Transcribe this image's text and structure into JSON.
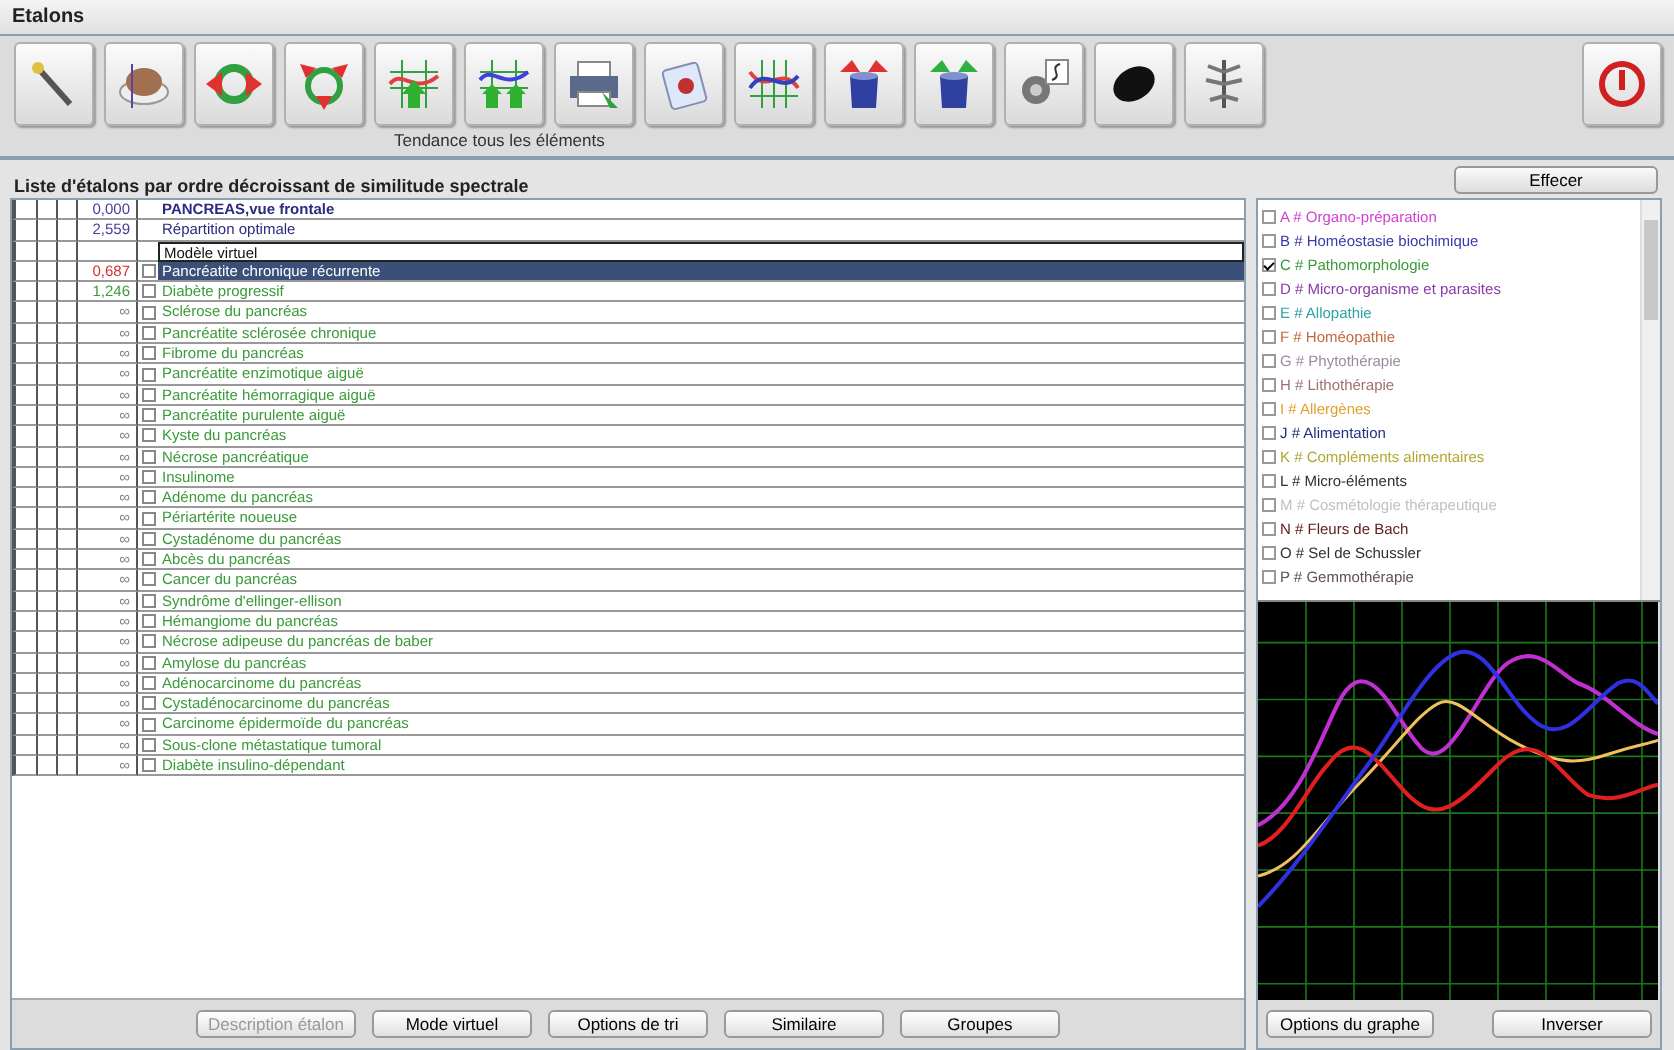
{
  "window": {
    "title": "Etalons"
  },
  "toolbar": {
    "buttons": [
      {
        "kind": "wand"
      },
      {
        "kind": "dish"
      },
      {
        "kind": "ring"
      },
      {
        "kind": "triangle"
      },
      {
        "kind": "graph-up"
      },
      {
        "kind": "graph-up2"
      },
      {
        "kind": "printer"
      },
      {
        "kind": "notepad"
      },
      {
        "kind": "waves"
      },
      {
        "kind": "cup-red"
      },
      {
        "kind": "cup-green"
      },
      {
        "kind": "gears"
      },
      {
        "kind": "stone"
      },
      {
        "kind": "plant"
      },
      {
        "kind": "power"
      }
    ],
    "caption": "Tendance tous les éléments"
  },
  "list_header": "Liste d'étalons par ordre décroissant de similitude spectrale",
  "clear_button": "Effecer",
  "table": {
    "rows": [
      {
        "kind": "reference",
        "value": "0,000",
        "color": "#4a3a9a",
        "name": "PANCREAS,vue frontale",
        "selected": false
      },
      {
        "kind": "optimal",
        "value": "2,559",
        "color": "#4a3a9a",
        "name": "Répartition optimale",
        "selected": false
      },
      {
        "kind": "virtual",
        "name": "Modèle virtuel",
        "selected": false
      },
      {
        "kind": "item",
        "value": "0,687",
        "color": "#d03030",
        "name": "Pancréatite chronique récurrente",
        "checked": false,
        "selected": true
      },
      {
        "kind": "item",
        "value": "1,246",
        "color": "#3a9a3a",
        "name": "Diabète progressif",
        "checked": false,
        "selected": false
      },
      {
        "kind": "item",
        "value": "∞",
        "color": "#808080",
        "name": "Sclérose du pancréas",
        "checked": false,
        "selected": false
      },
      {
        "kind": "item",
        "value": "∞",
        "color": "#808080",
        "name": "Pancréatite sclérosée chronique",
        "checked": false,
        "selected": false
      },
      {
        "kind": "item",
        "value": "∞",
        "color": "#808080",
        "name": "Fibrome du pancréas",
        "checked": false,
        "selected": false
      },
      {
        "kind": "item",
        "value": "∞",
        "color": "#808080",
        "name": "Pancréatite enzimotique aiguë",
        "checked": false,
        "selected": false
      },
      {
        "kind": "item",
        "value": "∞",
        "color": "#808080",
        "name": "Pancréatite hémorragique aiguë",
        "checked": false,
        "selected": false
      },
      {
        "kind": "item",
        "value": "∞",
        "color": "#808080",
        "name": "Pancréatite purulente aiguë",
        "checked": false,
        "selected": false
      },
      {
        "kind": "item",
        "value": "∞",
        "color": "#808080",
        "name": "Kyste du pancréas",
        "checked": false,
        "selected": false
      },
      {
        "kind": "item",
        "value": "∞",
        "color": "#808080",
        "name": "Nécrose pancréatique",
        "checked": false,
        "selected": false
      },
      {
        "kind": "item",
        "value": "∞",
        "color": "#808080",
        "name": "Insulinome",
        "checked": false,
        "selected": false
      },
      {
        "kind": "item",
        "value": "∞",
        "color": "#808080",
        "name": "Adénome du pancréas",
        "checked": false,
        "selected": false
      },
      {
        "kind": "item",
        "value": "∞",
        "color": "#808080",
        "name": "Périartérite noueuse",
        "checked": false,
        "selected": false
      },
      {
        "kind": "item",
        "value": "∞",
        "color": "#808080",
        "name": "Cystadénome du pancréas",
        "checked": false,
        "selected": false
      },
      {
        "kind": "item",
        "value": "∞",
        "color": "#808080",
        "name": "Abcès du pancréas",
        "checked": false,
        "selected": false
      },
      {
        "kind": "item",
        "value": "∞",
        "color": "#808080",
        "name": "Cancer du pancréas",
        "checked": false,
        "selected": false
      },
      {
        "kind": "item",
        "value": "∞",
        "color": "#808080",
        "name": "Syndrôme d'ellinger-ellison",
        "checked": false,
        "selected": false
      },
      {
        "kind": "item",
        "value": "∞",
        "color": "#808080",
        "name": "Hémangiome du pancréas",
        "checked": false,
        "selected": false
      },
      {
        "kind": "item",
        "value": "∞",
        "color": "#808080",
        "name": "Nécrose adipeuse du pancréas de baber",
        "checked": false,
        "selected": false
      },
      {
        "kind": "item",
        "value": "∞",
        "color": "#808080",
        "name": "Amylose du pancréas",
        "checked": false,
        "selected": false
      },
      {
        "kind": "item",
        "value": "∞",
        "color": "#808080",
        "name": "Adénocarcinome du pancréas",
        "checked": false,
        "selected": false
      },
      {
        "kind": "item",
        "value": "∞",
        "color": "#808080",
        "name": "Cystadénocarcinome du pancréas",
        "checked": false,
        "selected": false
      },
      {
        "kind": "item",
        "value": "∞",
        "color": "#808080",
        "name": "Carcinome épidermoïde du pancréas",
        "checked": false,
        "selected": false
      },
      {
        "kind": "item",
        "value": "∞",
        "color": "#808080",
        "name": "Sous-clone métastatique tumoral",
        "checked": false,
        "selected": false
      },
      {
        "kind": "item",
        "value": "∞",
        "color": "#808080",
        "name": "Diabète insulino-dépendant",
        "checked": false,
        "selected": false
      }
    ]
  },
  "table_buttons": [
    {
      "label": "Description étalon",
      "disabled": true
    },
    {
      "label": "Mode virtuel",
      "disabled": false
    },
    {
      "label": "Options de tri",
      "disabled": false
    },
    {
      "label": "Similaire",
      "disabled": false
    },
    {
      "label": "Groupes",
      "disabled": false
    }
  ],
  "groups": [
    {
      "label": "A # Organo-préparation",
      "color": "#d040d0",
      "checked": false
    },
    {
      "label": "B # Homéostasie biochimique",
      "color": "#3a3aa8",
      "checked": false
    },
    {
      "label": "C # Pathomorphologie",
      "color": "#3a9a3a",
      "checked": true
    },
    {
      "label": "D # Micro-organisme et parasites",
      "color": "#8a3aa8",
      "checked": false
    },
    {
      "label": "E # Allopathie",
      "color": "#30a0a0",
      "checked": false
    },
    {
      "label": "F # Homéopathie",
      "color": "#c06a40",
      "checked": false
    },
    {
      "label": "G # Phytothérapie",
      "color": "#9a8aa0",
      "checked": false
    },
    {
      "label": "H # Lithothérapie",
      "color": "#a07070",
      "checked": false
    },
    {
      "label": "I # Allergènes",
      "color": "#e0a030",
      "checked": false
    },
    {
      "label": "J # Alimentation",
      "color": "#203080",
      "checked": false
    },
    {
      "label": "K # Compléments alimentaires",
      "color": "#b0a830",
      "checked": false
    },
    {
      "label": "L # Micro-éléments",
      "color": "#303030",
      "checked": false
    },
    {
      "label": "M # Cosmétologie thérapeutique",
      "color": "#c0c0c0",
      "checked": false
    },
    {
      "label": "N # Fleurs de Bach",
      "color": "#602020",
      "checked": false
    },
    {
      "label": "O # Sel de Schussler",
      "color": "#303030",
      "checked": false
    },
    {
      "label": "P # Gemmothérapie",
      "color": "#605050",
      "checked": false
    }
  ],
  "graph_buttons": [
    "Options du graphe",
    "Inverser"
  ]
}
